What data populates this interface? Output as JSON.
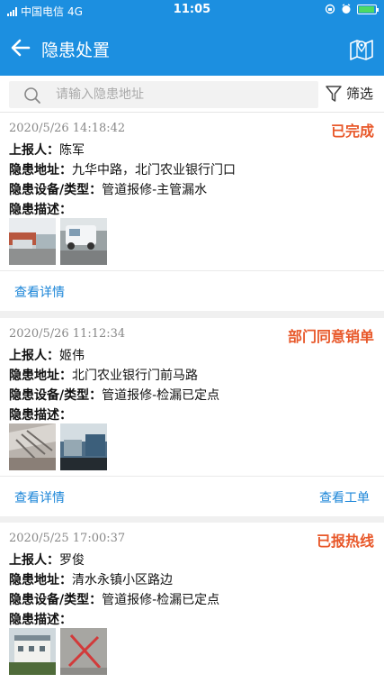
{
  "status_bar": {
    "carrier": "中国电信",
    "network": "4G",
    "time": "11:05"
  },
  "header": {
    "title": "隐患处置",
    "back_icon": "arrow-left-icon",
    "map_icon": "map-icon"
  },
  "search": {
    "placeholder": "请输入隐患地址",
    "filter_label": "筛选"
  },
  "labels": {
    "reporter": "上报人：",
    "address": "隐患地址：",
    "device_type": "隐患设备/类型：",
    "description": "隐患描述："
  },
  "records": [
    {
      "date": "2020/5/26 14:18:42",
      "status": "已完成",
      "reporter": "陈军",
      "address": "九华中路，北门农业银行门口",
      "device_type": "管道报修-主管漏水",
      "description": "",
      "actions": {
        "details": "查看详情",
        "work_order": ""
      }
    },
    {
      "date": "2020/5/26 11:12:34",
      "status": "部门同意销单",
      "reporter": "姬伟",
      "address": "北门农业银行门前马路",
      "device_type": "管道报修-检漏已定点",
      "description": "",
      "actions": {
        "details": "查看详情",
        "work_order": "查看工单"
      }
    },
    {
      "date": "2020/5/25 17:00:37",
      "status": "已报热线",
      "reporter": "罗俊",
      "address": "清水永镇小区路边",
      "device_type": "管道报修-检漏已定点",
      "description": "",
      "actions": {
        "details": "",
        "work_order": ""
      }
    }
  ],
  "colors": {
    "primary": "#1c8fe0",
    "status": "#e8582a",
    "link": "#1c86d8"
  }
}
